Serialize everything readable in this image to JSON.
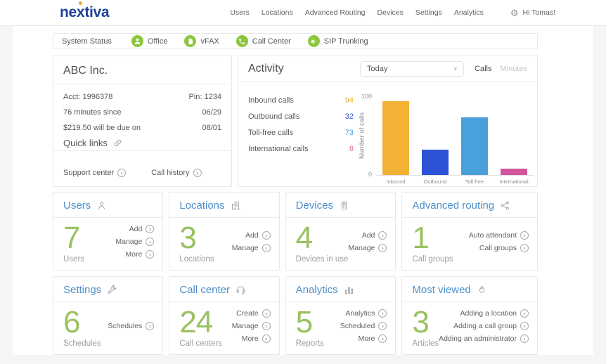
{
  "brand": {
    "logo_parts": [
      "ne",
      "x",
      "tiva"
    ],
    "logo_color": "#20409a",
    "dot_color": "#f6a821"
  },
  "header": {
    "nav": [
      "Users",
      "Locations",
      "Advanced Routing",
      "Devices",
      "Settings",
      "Analytics"
    ],
    "greeting": "Hi Tomas!"
  },
  "status_bar": {
    "label": "System Status",
    "items": [
      {
        "name": "Office",
        "icon": "office-person-icon"
      },
      {
        "name": "vFAX",
        "icon": "fax-document-icon"
      },
      {
        "name": "Call Center",
        "icon": "phone-icon"
      },
      {
        "name": "SIP Trunking",
        "icon": "speaker-icon"
      }
    ],
    "status_green": "#8dc63f"
  },
  "account": {
    "title": "ABC Inc.",
    "rows": [
      {
        "left": "Acct: 1996378",
        "right": "Pin: 1234"
      },
      {
        "left": "76 minutes since",
        "right": "06/29"
      },
      {
        "left": "$219.50 will be due on",
        "right": "08/01"
      }
    ],
    "quick_links_label": "Quick links",
    "footer_links": [
      "Support center",
      "Call history"
    ]
  },
  "activity": {
    "title": "Activity",
    "period": "Today",
    "toggle": {
      "options": [
        "Calls",
        "Minutes"
      ],
      "selected": "Calls"
    },
    "stats": [
      {
        "label": "Inbound calls",
        "value": 94,
        "color": "#f2b236"
      },
      {
        "label": "Outbound calls",
        "value": 32,
        "color": "#3c5bd2"
      },
      {
        "label": "Toll-free calls",
        "value": 73,
        "color": "#49a0db"
      },
      {
        "label": "International calls",
        "value": 8,
        "color": "#e0689e"
      }
    ]
  },
  "chart_data": {
    "type": "bar",
    "categories": [
      "Inbound",
      "Outbound",
      "Toll free",
      "International"
    ],
    "values": [
      94,
      32,
      73,
      8
    ],
    "colors": [
      "#f2b236",
      "#2d52d5",
      "#49a0db",
      "#d1569b"
    ],
    "title": "",
    "xlabel": "",
    "ylabel": "Number of calls",
    "ylim": [
      0,
      100
    ],
    "yticks": [
      0,
      100
    ],
    "grid": false,
    "legend": false
  },
  "cards": [
    {
      "title": "Users",
      "icon": "users-icon",
      "count": "7",
      "count_label": "Users",
      "links": [
        "Add",
        "Manage",
        "More"
      ]
    },
    {
      "title": "Locations",
      "icon": "locations-icon",
      "count": "3",
      "count_label": "Locations",
      "links": [
        "Add",
        "Manage"
      ]
    },
    {
      "title": "Devices",
      "icon": "devices-icon",
      "count": "4",
      "count_label": "Devices in use",
      "links": [
        "Add",
        "Manage"
      ]
    },
    {
      "title": "Advanced routing",
      "icon": "routing-icon",
      "count": "1",
      "count_label": "Call groups",
      "links": [
        "Auto attendant",
        "Call groups"
      ]
    },
    {
      "title": "Settings",
      "icon": "settings-icon",
      "count": "6",
      "count_label": "Schedules",
      "links": [
        "Schedules"
      ]
    },
    {
      "title": "Call center",
      "icon": "call-center-icon",
      "count": "24",
      "count_label": "Call centers",
      "links": [
        "Create",
        "Manage",
        "More"
      ]
    },
    {
      "title": "Analytics",
      "icon": "analytics-icon",
      "count": "5",
      "count_label": "Reports",
      "links": [
        "Analytics",
        "Scheduled",
        "More"
      ]
    },
    {
      "title": "Most viewed",
      "icon": "most-viewed-icon",
      "count": "3",
      "count_label": "Articles",
      "links": [
        "Adding a location",
        "Adding a call group",
        "Adding an administrator"
      ]
    }
  ],
  "colors": {
    "card_title_blue": "#4e90cc",
    "count_green": "#9ac261"
  }
}
